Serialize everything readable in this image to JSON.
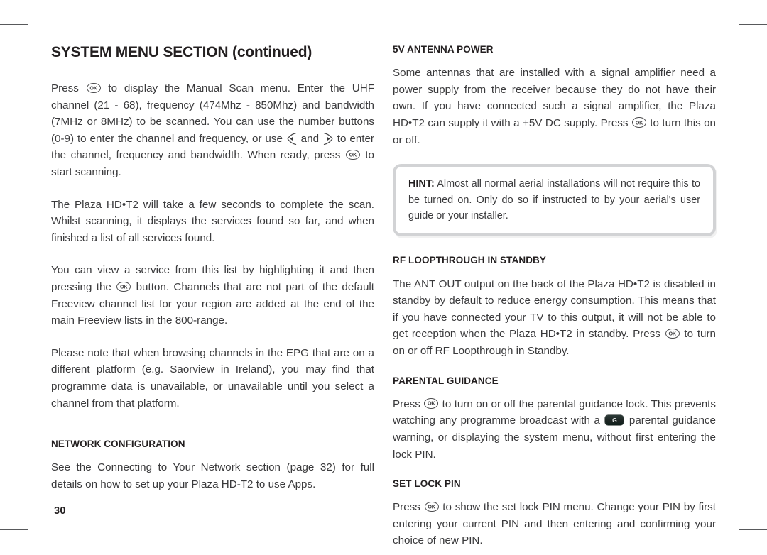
{
  "page": {
    "number": "30",
    "title": "SYSTEM MENU SECTION (continued)"
  },
  "icons": {
    "ok_label": "OK",
    "left_arrow_name": "left-arrow-key-icon",
    "right_arrow_name": "right-arrow-key-icon",
    "pg_badge_label": "G"
  },
  "left_column": {
    "paragraphs": {
      "manual_scan_p1_a": "Press ",
      "manual_scan_p1_b": " to display the Manual Scan menu. Enter the UHF channel (21 - 68), frequency (474Mhz - 850Mhz) and bandwidth (7MHz or 8MHz) to be scanned. You can use the number buttons (0-9) to enter the channel and frequency, or use ",
      "manual_scan_p1_c": " and ",
      "manual_scan_p1_d": " to enter the channel, frequency and bandwidth. When ready, press ",
      "manual_scan_p1_e": " to start scanning.",
      "scan_progress": "The Plaza HD•T2 will take a few seconds to complete the scan. Whilst scanning, it displays the services found so far, and when finished a list of all services found.",
      "view_service_a": "You can view a service from this list by highlighting it and then pressing the ",
      "view_service_b": " button. Channels that are not part of the default Freeview channel list for your region are added at the end of the main Freeview lists in the 800-range.",
      "epg_note": "Please note that when browsing channels in the EPG that are on a different platform (e.g. Saorview in Ireland), you may find that programme data is unavailable, or unavailable until you select a channel from that platform."
    },
    "network_configuration": {
      "heading": "NETWORK CONFIGURATION",
      "body": "See the Connecting to Your Network section (page 32) for full details on how to set up your Plaza HD-T2 to use Apps."
    }
  },
  "right_column": {
    "antenna_power": {
      "heading": "5V ANTENNA POWER",
      "body_a": "Some antennas that are installed with a signal amplifier need a power supply from the receiver because they do not have their own. If you have connected such a signal amplifier, the Plaza HD•T2 can supply it with a +5V DC supply. Press ",
      "body_b": " to turn this on or off."
    },
    "hint": {
      "label": "HINT:",
      "body": " Almost all normal aerial installations will not require this to be turned on. Only do so if instructed to by your aerial's user guide or your installer."
    },
    "rf_loopthrough": {
      "heading": "RF LOOPTHROUGH IN STANDBY",
      "body_a": "The ANT OUT output on the back of the Plaza HD•T2 is disabled in standby by default to reduce energy consumption. This means that if you have connected your TV to this output, it will not be able to get reception when the Plaza HD•T2 in standby. Press ",
      "body_b": " to turn on or off RF Loopthrough in Standby."
    },
    "parental_guidance": {
      "heading": "PARENTAL GUIDANCE",
      "body_a": "Press ",
      "body_b": " to turn on or off the parental guidance lock. This prevents watching any programme broadcast with a ",
      "body_c": " parental guidance warning, or displaying the system menu, without first entering the lock PIN."
    },
    "set_lock_pin": {
      "heading": "SET LOCK PIN",
      "body_a": "Press ",
      "body_b": " to show the set lock PIN menu. Change your PIN by first entering your current PIN and then entering and confirming your choice of new PIN."
    }
  }
}
